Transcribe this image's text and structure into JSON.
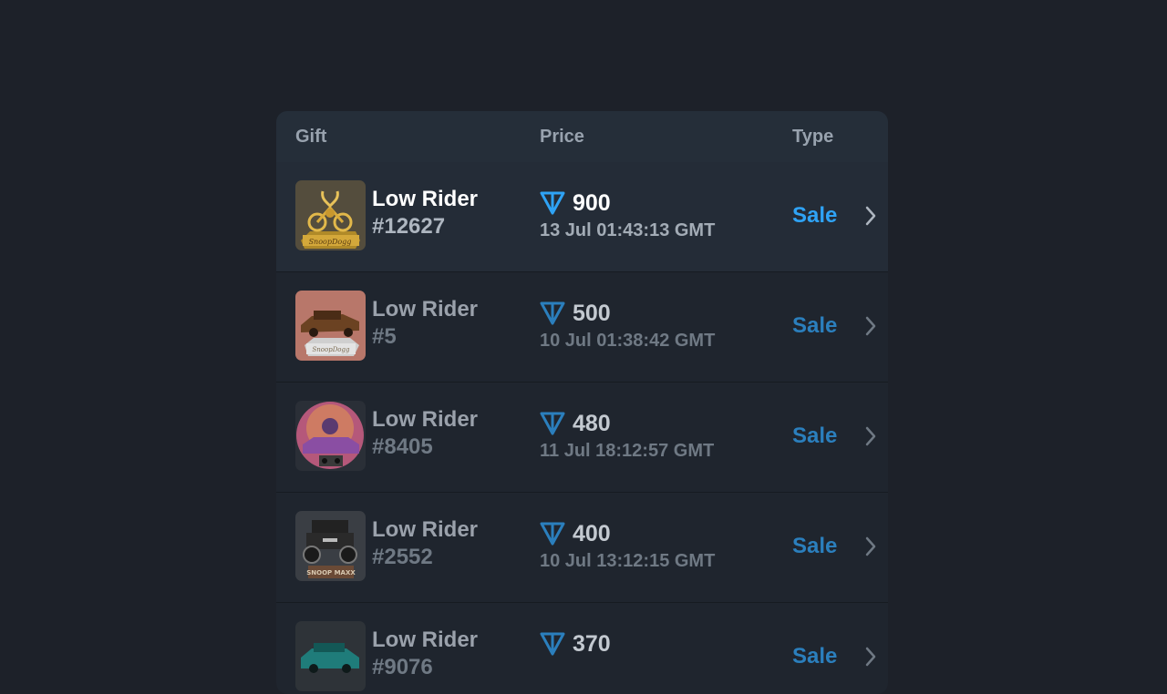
{
  "table": {
    "headers": {
      "gift": "Gift",
      "price": "Price",
      "type": "Type"
    },
    "rows": [
      {
        "name": "Low Rider",
        "number": "#12627",
        "price": "900",
        "date": "13 Jul 01:43:13 GMT",
        "type": "Sale",
        "icon": "golden-lowrider-bike-image"
      },
      {
        "name": "Low Rider",
        "number": "#5",
        "price": "500",
        "date": "10 Jul 01:38:42 GMT",
        "type": "Sale",
        "icon": "brown-lowrider-car-image"
      },
      {
        "name": "Low Rider",
        "number": "#8405",
        "price": "480",
        "date": "11 Jul 18:12:57 GMT",
        "type": "Sale",
        "icon": "purple-lowrider-car-image"
      },
      {
        "name": "Low Rider",
        "number": "#2552",
        "price": "400",
        "date": "10 Jul 13:12:15 GMT",
        "type": "Sale",
        "icon": "black-monster-car-image"
      },
      {
        "name": "Low Rider",
        "number": "#9076",
        "price": "370",
        "date": "",
        "type": "Sale",
        "icon": "teal-lowrider-car-image"
      }
    ]
  },
  "colors": {
    "background": "#1d2129",
    "panel": "#1f252e",
    "header": "#252e39",
    "accent": "#2fa3f5"
  }
}
